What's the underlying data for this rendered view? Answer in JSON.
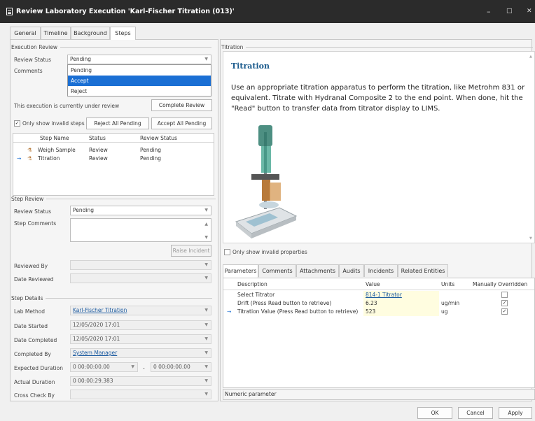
{
  "window": {
    "title": "Review Laboratory Execution 'Karl-Fischer Titration (013)'",
    "minimize": "–",
    "maximize": "□",
    "close": "✕"
  },
  "tabs": [
    "General",
    "Timeline",
    "Background",
    "Steps"
  ],
  "execution_review": {
    "section": "Execution Review",
    "review_status_label": "Review Status",
    "review_status_value": "Pending",
    "comments_label": "Comments",
    "dropdown_options": [
      "Pending",
      "Accept",
      "Reject"
    ],
    "status_text": "This execution is currently under review",
    "complete_review_btn": "Complete Review",
    "only_invalid_steps": "Only show invalid steps",
    "reject_all_btn": "Reject All Pending",
    "accept_all_btn": "Accept All Pending"
  },
  "steps_table": {
    "headers": [
      "Step Name",
      "Status",
      "Review Status"
    ],
    "rows": [
      {
        "name": "Weigh Sample",
        "status": "Review",
        "review": "Pending"
      },
      {
        "name": "Titration",
        "status": "Review",
        "review": "Pending"
      }
    ]
  },
  "step_review": {
    "section": "Step Review",
    "review_status_label": "Review Status",
    "review_status_value": "Pending",
    "step_comments_label": "Step Comments",
    "raise_incident_btn": "Raise Incident",
    "reviewed_by_label": "Reviewed By",
    "date_reviewed_label": "Date Reviewed"
  },
  "step_details": {
    "section": "Step Details",
    "lab_method_label": "Lab Method",
    "lab_method_value": "Karl-Fischer Titration",
    "date_started_label": "Date Started",
    "date_started_value": "12/05/2020 17:01",
    "date_completed_label": "Date Completed",
    "date_completed_value": "12/05/2020 17:01",
    "completed_by_label": "Completed By",
    "completed_by_value": "System Manager",
    "expected_duration_label": "Expected Duration",
    "expected_duration_from": "0 00:00:00.00",
    "expected_duration_sep": "-",
    "expected_duration_to": "0 00:00:00.00",
    "actual_duration_label": "Actual Duration",
    "actual_duration_value": "0 00:00:29.383",
    "cross_check_label": "Cross Check By"
  },
  "titration": {
    "section": "Titration",
    "heading": "Titration",
    "body": "Use an appropriate titration apparatus to perform the titration, like Metrohm 831 or equivalent. Titrate with Hydranal Composite 2 to the end point. When done, hit the \"Read\" button to transfer data from titrator display to LIMS."
  },
  "only_invalid_properties": "Only show invalid properties",
  "bottom_tabs": [
    "Parameters",
    "Comments",
    "Attachments",
    "Audits",
    "Incidents",
    "Related Entities"
  ],
  "parameters": {
    "headers": [
      "Description",
      "Value",
      "Units",
      "Manually Overridden"
    ],
    "rows": [
      {
        "desc": "Select Titrator",
        "value": "814-1 Titrator",
        "units": "",
        "overridden": ""
      },
      {
        "desc": "Drift (Press Read button to retrieve)",
        "value": "6.23",
        "units": "ug/min",
        "overridden": "✓"
      },
      {
        "desc": "Titration Value (Press Read button to retrieve)",
        "value": "523",
        "units": "ug",
        "overridden": "✓"
      }
    ]
  },
  "status_bar": "Numeric parameter",
  "footer": {
    "ok": "OK",
    "cancel": "Cancel",
    "apply": "Apply"
  },
  "colors": {
    "selection": "#1a6fd4",
    "titlebar": "#2b2b2b",
    "heading": "#1a5a8c",
    "link": "#1a5aa0",
    "value_cell": "#fffde0"
  }
}
